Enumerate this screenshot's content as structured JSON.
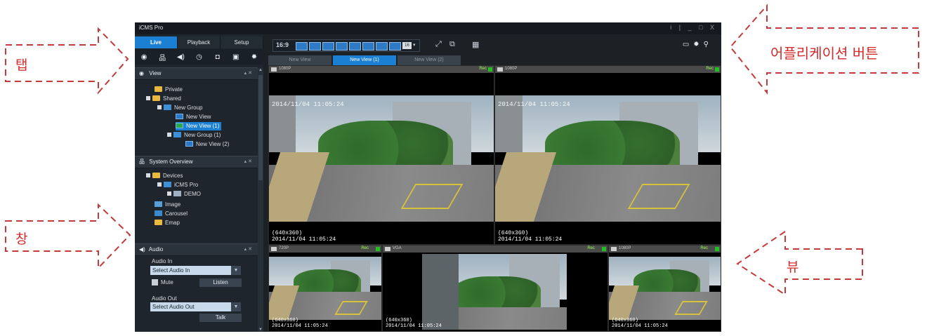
{
  "window": {
    "title": "iCMS Pro",
    "controls": "i | _ □ X"
  },
  "tabs": [
    {
      "label": "Live",
      "active": true
    },
    {
      "label": "Playback"
    },
    {
      "label": "Setup"
    }
  ],
  "tool_icons": [
    "eye-icon",
    "network-icon",
    "speaker-icon",
    "clock-icon",
    "camera-icon",
    "monitor-icon",
    "gear-icon"
  ],
  "view_section": {
    "title": "View",
    "tree": [
      "Private",
      "Shared",
      "New Group",
      "New View",
      "New View (1)",
      "New Group (1)",
      "New View (2)"
    ],
    "selected": "New View (1)"
  },
  "system_section": {
    "title": "System Overview",
    "tree": [
      "Devices",
      "iCMS Pro",
      "DEMO",
      "Image",
      "Carousel",
      "Emap"
    ]
  },
  "audio_section": {
    "title": "Audio",
    "audio_in_label": "Audio In",
    "audio_in_select": "Select Audio In",
    "mute_label": "Mute",
    "listen_label": "Listen",
    "audio_out_label": "Audio Out",
    "audio_out_select": "Select Audio Out",
    "talk_label": "Talk"
  },
  "toolbar": {
    "ratio": "16:9",
    "layout_max": "16"
  },
  "view_tabs": [
    {
      "label": "New View"
    },
    {
      "label": "New View (1)",
      "active": true
    },
    {
      "label": "New View (2)"
    }
  ],
  "tiles": [
    {
      "channel": "1080P",
      "rec": "Rec",
      "timestamp": "2014/11/04 11:05:24",
      "resolution": "(640x360)",
      "datetime": "2014/11/04 11:05:24"
    },
    {
      "channel": "1080P",
      "rec": "Rec",
      "timestamp": "2014/11/04 11:05:24",
      "resolution": "(640x360)",
      "datetime": "2014/11/04 11:05:24"
    },
    {
      "channel": "720P",
      "rec": "Rec",
      "resolution": "(640x360)",
      "datetime": "2014/11/04 11:05:24"
    },
    {
      "channel": "VGA",
      "rec": "Rec",
      "resolution": "(640x360)",
      "datetime": "2014/11/04 11:05:24"
    },
    {
      "channel": "1080P",
      "rec": "Rec",
      "resolution": "(640x360)",
      "datetime": "2014/11/04 11:05:24"
    }
  ],
  "annotations": {
    "tab": "탭",
    "window": "창",
    "app_buttons": "어플리케이션 버튼",
    "view": "뷰",
    "color": "#d42a2a"
  }
}
